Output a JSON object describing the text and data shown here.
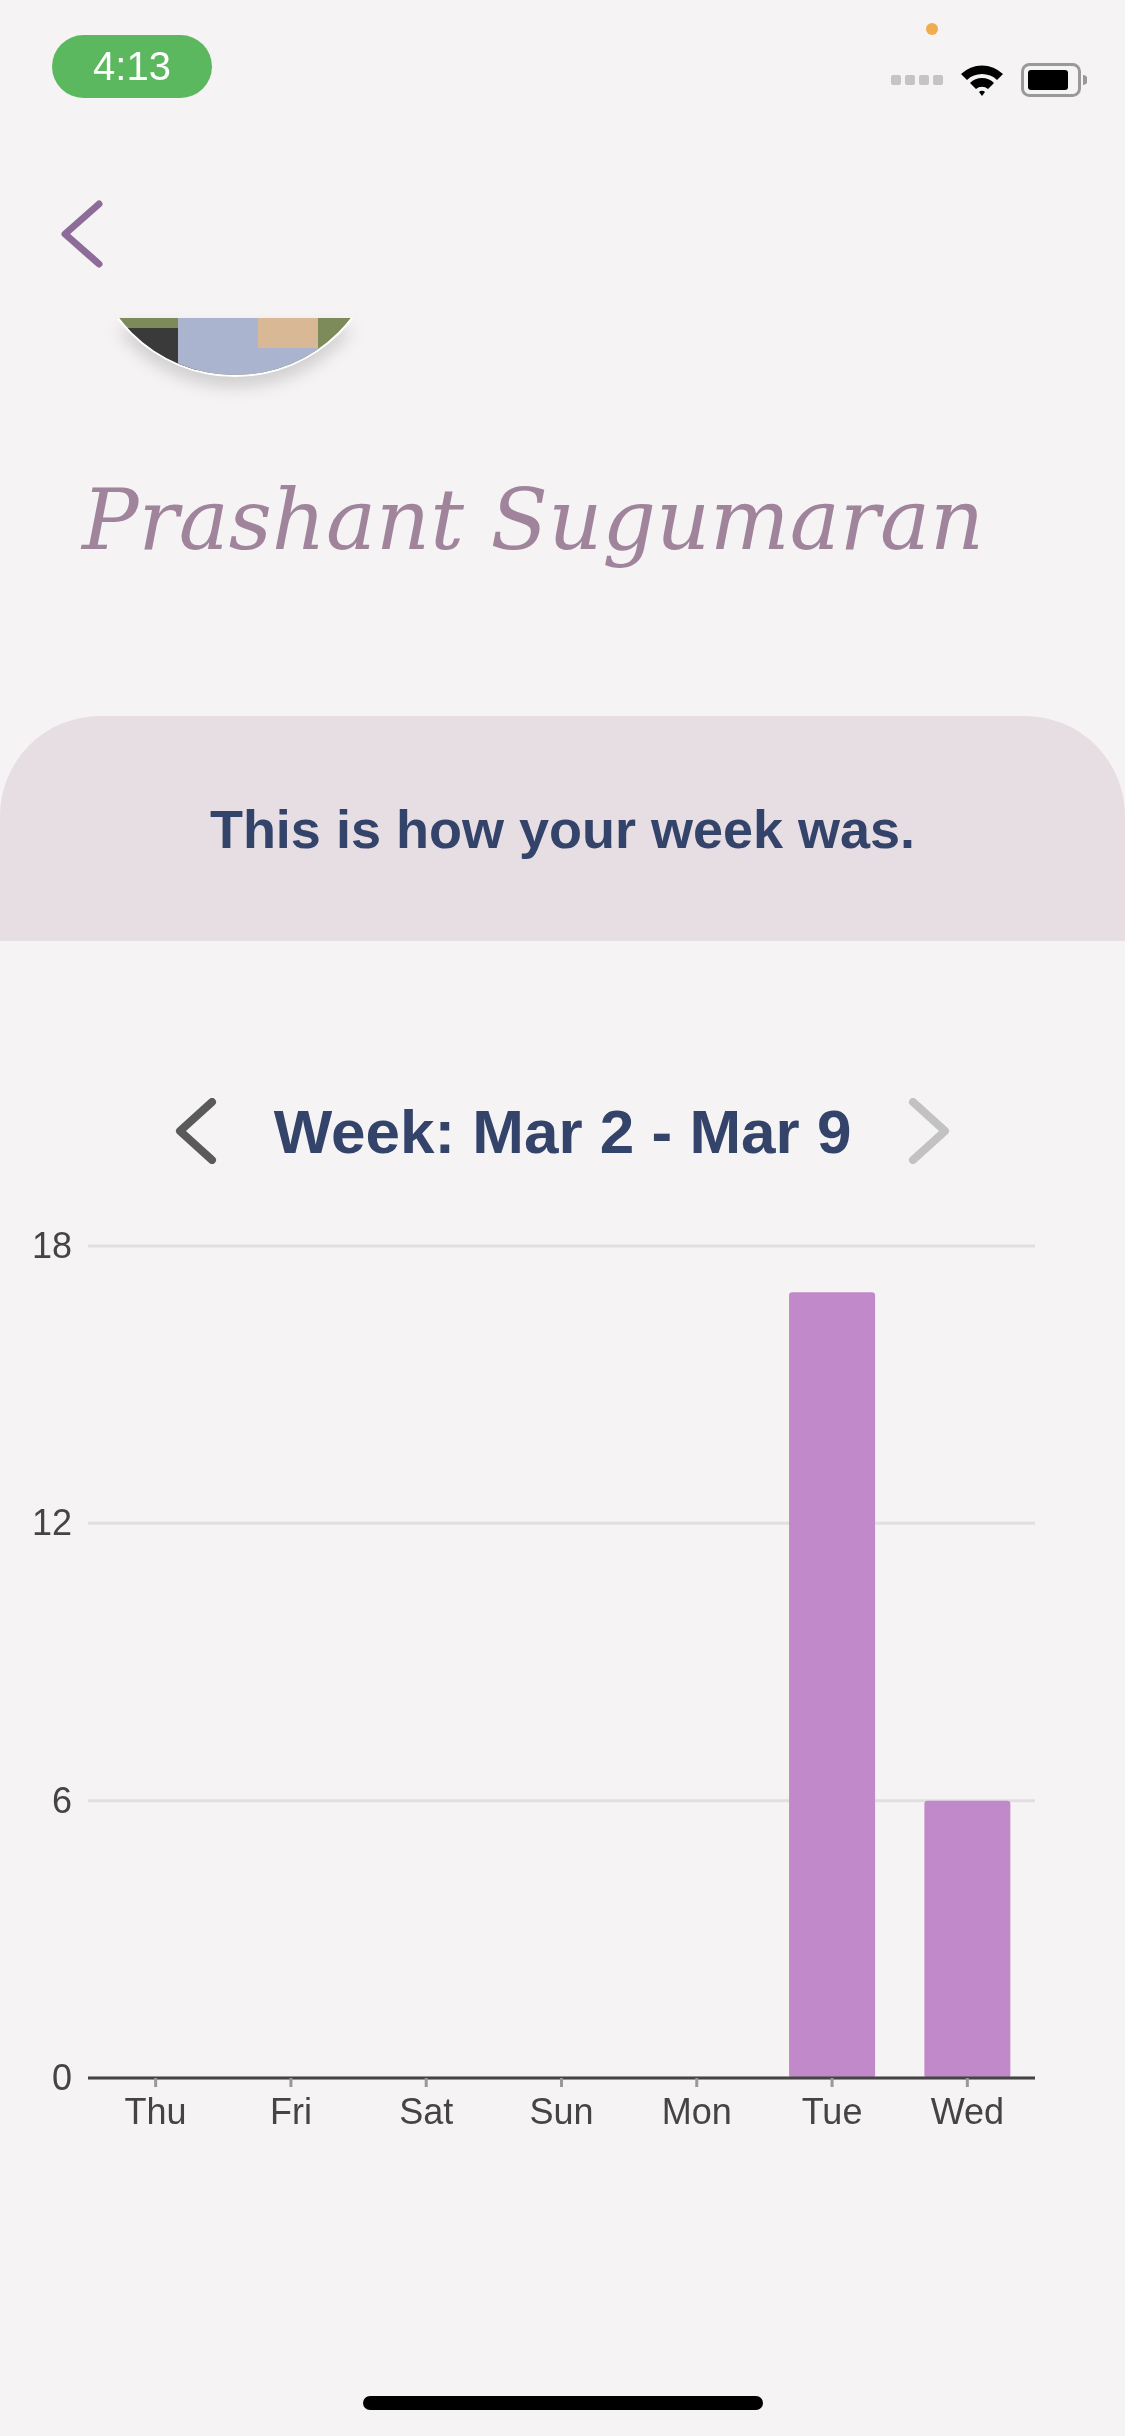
{
  "status_bar": {
    "time": "4:13"
  },
  "profile": {
    "name": "Prashant Sugumaran"
  },
  "summary": {
    "title": "This is how your week was."
  },
  "week_nav": {
    "label": "Week: Mar 2 - Mar 9",
    "prev_disabled": false,
    "next_disabled": true
  },
  "chart_data": {
    "type": "bar",
    "categories": [
      "Thu",
      "Fri",
      "Sat",
      "Sun",
      "Mon",
      "Tue",
      "Wed"
    ],
    "values": [
      0,
      0,
      0,
      0,
      0,
      17,
      6
    ],
    "ylim": [
      0,
      18
    ],
    "yticks": [
      0,
      6,
      12,
      18
    ]
  }
}
